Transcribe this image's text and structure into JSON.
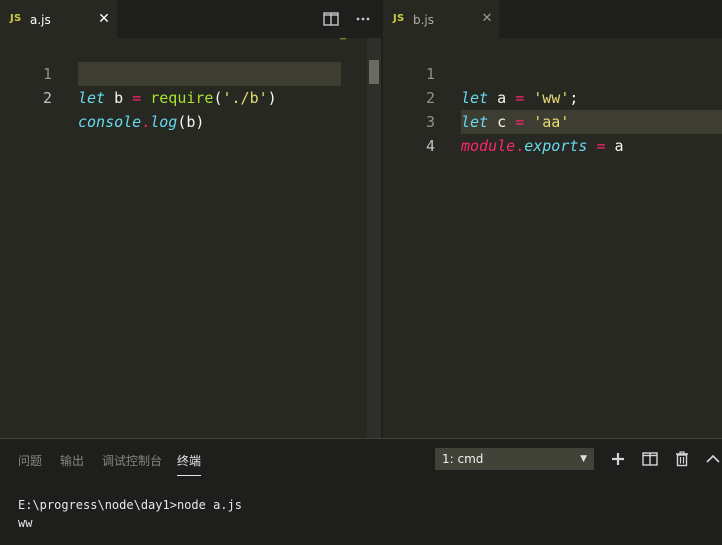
{
  "left_editor": {
    "tab": {
      "icon": "JS",
      "filename": "a.js",
      "close": "✕",
      "active": true
    },
    "actions": [
      "split-editor-icon",
      "more-actions-icon"
    ],
    "lines": [
      {
        "number": "1",
        "tokens": [
          {
            "t": "let",
            "k": "kw"
          },
          {
            "t": " b ",
            "k": "plain"
          },
          {
            "t": "=",
            "k": "op"
          },
          {
            "t": " ",
            "k": "plain"
          },
          {
            "t": "require",
            "k": "fn"
          },
          {
            "t": "(",
            "k": "plain"
          },
          {
            "t": "'./b'",
            "k": "str"
          },
          {
            "t": ")",
            "k": "plain"
          }
        ]
      },
      {
        "number": "2",
        "tokens": [
          {
            "t": "console",
            "k": "prop"
          },
          {
            "t": ".",
            "k": "op"
          },
          {
            "t": "log",
            "k": "prop"
          },
          {
            "t": "(",
            "k": "plain"
          },
          {
            "t": "b",
            "k": "plain"
          },
          {
            "t": ")",
            "k": "plain"
          }
        ]
      }
    ],
    "active_line": "2"
  },
  "right_editor": {
    "tab": {
      "icon": "JS",
      "filename": "b.js",
      "close": "✕",
      "active": false
    },
    "lines": [
      {
        "number": "1",
        "tokens": [
          {
            "t": "let",
            "k": "kw"
          },
          {
            "t": " a ",
            "k": "plain"
          },
          {
            "t": "=",
            "k": "op"
          },
          {
            "t": " ",
            "k": "plain"
          },
          {
            "t": "'ww'",
            "k": "str"
          },
          {
            "t": ";",
            "k": "plain"
          }
        ]
      },
      {
        "number": "2",
        "tokens": [
          {
            "t": "let",
            "k": "kw"
          },
          {
            "t": " c ",
            "k": "plain"
          },
          {
            "t": "=",
            "k": "op"
          },
          {
            "t": " ",
            "k": "plain"
          },
          {
            "t": "'aa'",
            "k": "str"
          }
        ]
      },
      {
        "number": "3",
        "tokens": [
          {
            "t": "module",
            "k": "mod"
          },
          {
            "t": ".",
            "k": "op"
          },
          {
            "t": "exports",
            "k": "prop"
          },
          {
            "t": " ",
            "k": "plain"
          },
          {
            "t": "=",
            "k": "op"
          },
          {
            "t": " a",
            "k": "plain"
          }
        ]
      },
      {
        "number": "4",
        "tokens": []
      }
    ],
    "active_line": "4"
  },
  "panel": {
    "tabs": [
      "问题",
      "输出",
      "调试控制台",
      "终端"
    ],
    "active_tab": "终端",
    "terminal_select": "1: cmd",
    "actions": [
      "add-terminal-icon",
      "split-terminal-icon",
      "trash-icon",
      "maximize-panel-icon"
    ],
    "terminal_lines": [
      "E:\\progress\\node\\day1>node a.js",
      "ww"
    ]
  },
  "colors": {
    "keyword": "#66d9ef",
    "function": "#a6e22e",
    "string": "#e6db74",
    "operator": "#f92672",
    "text": "#f8f8f2",
    "editor_bg": "#272822",
    "panel_bg": "#1e1f1c"
  }
}
